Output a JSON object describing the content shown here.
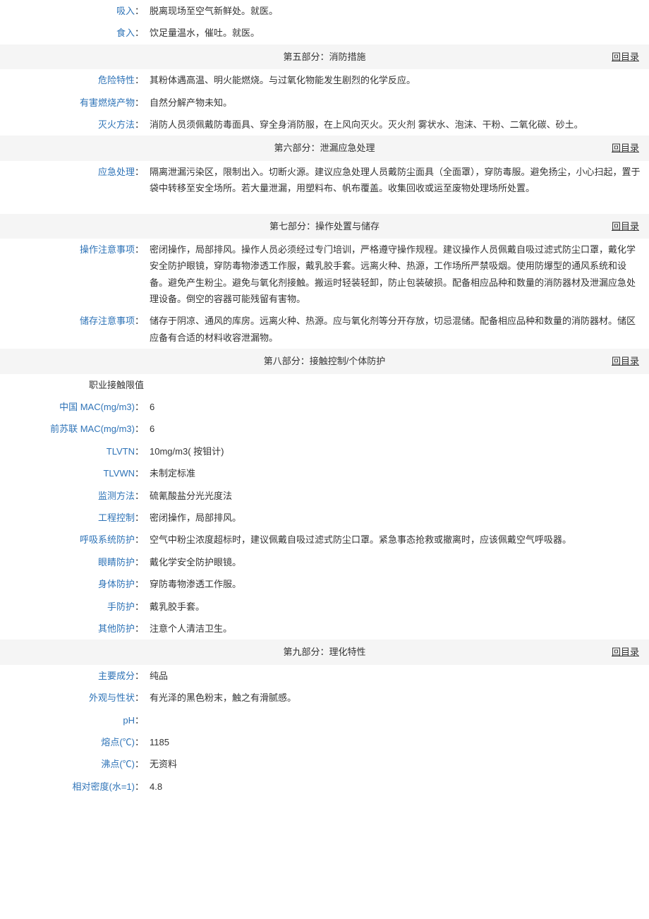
{
  "backLabel": "回目录",
  "sections": {
    "s4": {
      "rows": [
        {
          "label": "吸入",
          "value": "脱离现场至空气新鲜处。就医。"
        },
        {
          "label": "食入",
          "value": "饮足量温水，催吐。就医。"
        }
      ]
    },
    "s5": {
      "title": "第五部分：消防措施",
      "rows": [
        {
          "label": "危险特性",
          "value": "其粉体遇高温、明火能燃烧。与过氧化物能发生剧烈的化学反应。"
        },
        {
          "label": "有害燃烧产物",
          "value": "自然分解产物未知。"
        },
        {
          "label": "灭火方法",
          "value": "消防人员须佩戴防毒面具、穿全身消防服，在上风向灭火。灭火剂 雾状水、泡沫、干粉、二氧化碳、砂土。"
        }
      ]
    },
    "s6": {
      "title": "第六部分：泄漏应急处理",
      "rows": [
        {
          "label": "应急处理",
          "value": "隔离泄漏污染区，限制出入。切断火源。建议应急处理人员戴防尘面具（全面罩），穿防毒服。避免扬尘，小心扫起，置于袋中转移至安全场所。若大量泄漏，用塑料布、帆布覆盖。收集回收或运至废物处理场所处置。"
        }
      ]
    },
    "s7": {
      "title": "第七部分：操作处置与储存",
      "rows": [
        {
          "label": "操作注意事项",
          "value": "密闭操作，局部排风。操作人员必须经过专门培训，严格遵守操作规程。建议操作人员佩戴自吸过滤式防尘口罩，戴化学安全防护眼镜，穿防毒物渗透工作服，戴乳胶手套。远离火种、热源，工作场所严禁吸烟。使用防爆型的通风系统和设备。避免产生粉尘。避免与氧化剂接触。搬运时轻装轻卸，防止包装破损。配备相应品种和数量的消防器材及泄漏应急处理设备。倒空的容器可能残留有害物。"
        },
        {
          "label": "储存注意事项",
          "value": "储存于阴凉、通风的库房。远离火种、热源。应与氧化剂等分开存放，切忌混储。配备相应品种和数量的消防器材。储区应备有合适的材料收容泄漏物。"
        }
      ]
    },
    "s8": {
      "title": "第八部分：接触控制/个体防护",
      "rows": [
        {
          "label": "职业接触限值",
          "value": "",
          "labelBlack": true,
          "noColon": true
        },
        {
          "label": "中国 MAC(mg/m3)",
          "value": "6"
        },
        {
          "label": "前苏联 MAC(mg/m3)",
          "value": "6"
        },
        {
          "label": "TLVTN",
          "value": "10mg/m3( 按钼计)"
        },
        {
          "label": "TLVWN",
          "value": "未制定标准"
        },
        {
          "label": "监测方法",
          "value": "硫氰酸盐分光光度法"
        },
        {
          "label": "工程控制",
          "value": "密闭操作，局部排风。"
        },
        {
          "label": "呼吸系统防护",
          "value": "空气中粉尘浓度超标时，建议佩戴自吸过滤式防尘口罩。紧急事态抢救或撤离时，应该佩戴空气呼吸器。"
        },
        {
          "label": "眼睛防护",
          "value": "戴化学安全防护眼镜。"
        },
        {
          "label": "身体防护",
          "value": "穿防毒物渗透工作服。"
        },
        {
          "label": "手防护",
          "value": "戴乳胶手套。"
        },
        {
          "label": "其他防护",
          "value": "注意个人清洁卫生。"
        }
      ]
    },
    "s9": {
      "title": "第九部分：理化特性",
      "rows": [
        {
          "label": "主要成分",
          "value": "纯品"
        },
        {
          "label": "外观与性状",
          "value": "有光泽的黑色粉末，触之有滑腻感。"
        },
        {
          "label": "pH",
          "value": ""
        },
        {
          "label": "熔点(℃)",
          "value": "1185"
        },
        {
          "label": "沸点(℃)",
          "value": "无资料"
        },
        {
          "label": "相对密度(水=1)",
          "value": "4.8"
        }
      ]
    }
  }
}
